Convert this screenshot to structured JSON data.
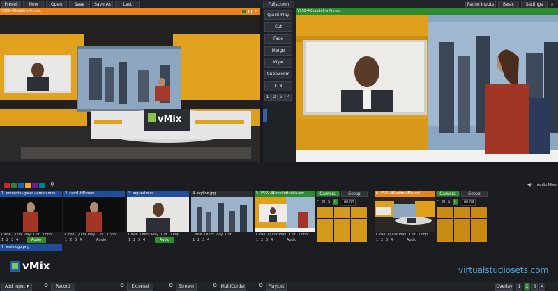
{
  "menu": {
    "preset": "Preset",
    "new": "New",
    "open": "Open",
    "save": "Save",
    "save_as": "Save As",
    "last": "Last"
  },
  "preview": {
    "title": "VSS9-4K-wide-vMix-set"
  },
  "program": {
    "title": "VSS9-4K-midleft-vMix-set"
  },
  "top_right": {
    "fullscreen": "Fullscreen",
    "pause_inputs": "Pause Inputs",
    "basic": "Basic",
    "settings": "Settings"
  },
  "transitions": {
    "quick_play": "Quick Play",
    "cut": "Cut",
    "fade": "Fade",
    "merge": "Merge",
    "wipe": "Wipe",
    "cubezoom": "CubeZoom",
    "ftb": "FTB",
    "nums": [
      "1",
      "2",
      "3",
      "4"
    ]
  },
  "scene_text": {
    "vmix_sign": "vMix"
  },
  "swatches": [
    "#c62828",
    "#2e7d32",
    "#1565c0",
    "#f9a825",
    "#6a1b9a",
    "#00838f"
  ],
  "audio_mixer": "Audio Mixer",
  "inputs": [
    {
      "num": "1",
      "name": "presenter-green-screen.mov",
      "color": "#1f4f9a"
    },
    {
      "num": "2",
      "name": "cam1-HD.mov",
      "color": "#1f4f9a"
    },
    {
      "num": "3",
      "name": "argued.mov",
      "color": "#1f4f9a"
    },
    {
      "num": "4",
      "name": "skyline.jpg",
      "color": "#2a2d33"
    },
    {
      "num": "5",
      "name": "VSS9-4K-midleft-vMix-set",
      "color": "#2e8b2e"
    },
    {
      "num": "6",
      "name": "VSS9-4K-wide-vMix-set",
      "color": "#e8841a"
    }
  ],
  "input_controls": {
    "close": "Close",
    "quick_play": "Quick Play",
    "cut": "Cut",
    "loop": "Loop",
    "audio": "Audio",
    "nums": [
      "1",
      "2",
      "3",
      "4"
    ]
  },
  "set_controls": {
    "camera": "Camera",
    "setup": "Setup",
    "fmsc": [
      "F",
      "M",
      "S",
      "C"
    ],
    "time5": "00:00",
    "time6": "00:04"
  },
  "input7": {
    "num": "7",
    "name": "vmixlogo.png"
  },
  "logo_text": "vMix",
  "watermark": "virtualstudiosets.com",
  "bottom": {
    "add_input": "Add Input",
    "record": "Record",
    "external": "External",
    "stream": "Stream",
    "multicorder": "MultiCorder",
    "playlist": "PlayList",
    "overlay": "Overlay",
    "overlay_nums": [
      "1",
      "2",
      "3",
      "4"
    ]
  }
}
